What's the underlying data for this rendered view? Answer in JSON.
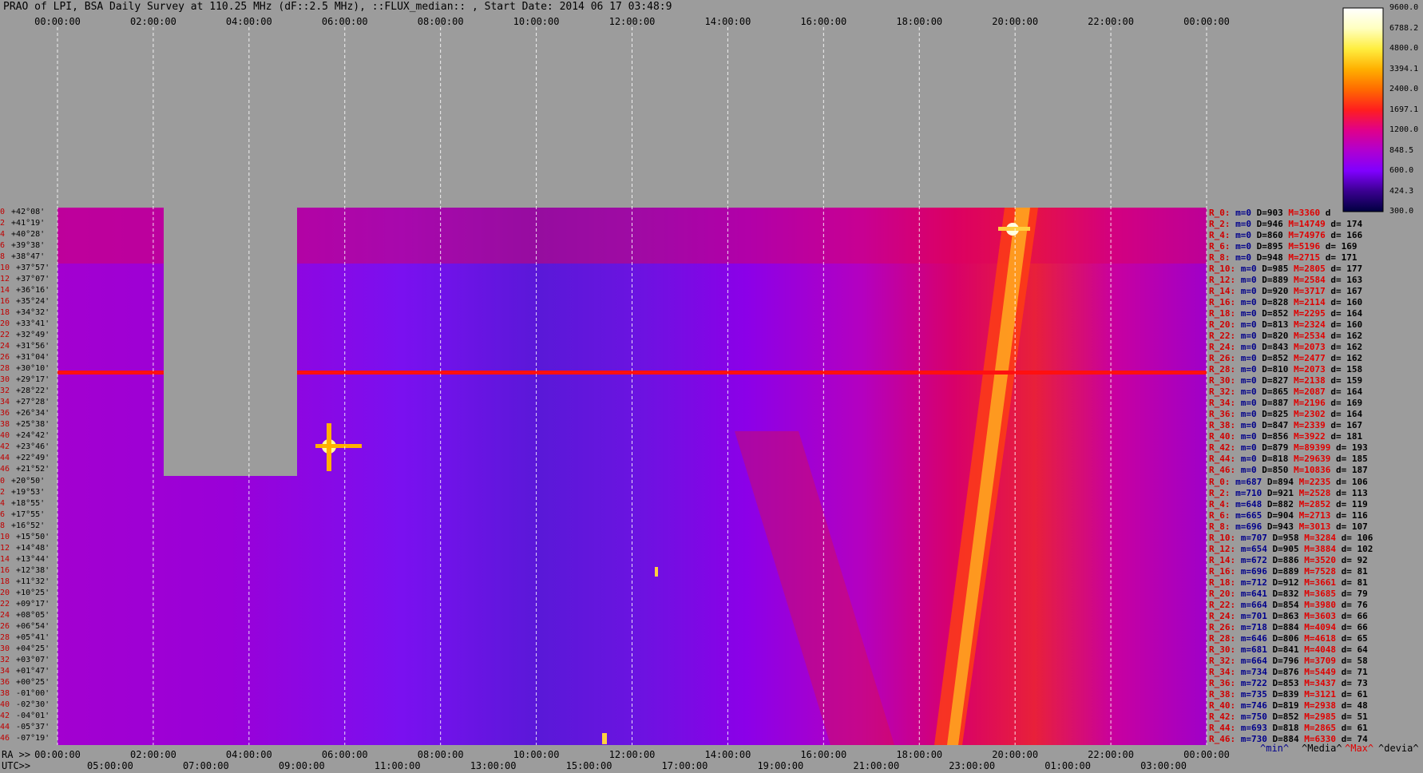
{
  "title": "PRAO of LPI, BSA Daily Survey at 110.25 MHz (dF::2.5 MHz), ::FLUX_median:: , Start Date: 2014 06 17 03:48:9",
  "chart_data": {
    "type": "heatmap",
    "title": "PRAO of LPI, BSA Daily Survey at 110.25 MHz (dF::2.5 MHz), ::FLUX_median:: , Start Date: 2014 06 17 03:48:9",
    "ra_ticks": [
      "00:00:00",
      "02:00:00",
      "04:00:00",
      "06:00:00",
      "08:00:00",
      "10:00:00",
      "12:00:00",
      "14:00:00",
      "16:00:00",
      "18:00:00",
      "20:00:00",
      "22:00:00",
      "00:00:00"
    ],
    "ra_axis_label": "RA >>",
    "utc_axis_label": "UTC>>",
    "utc_ticks": [
      "05:00:00",
      "07:00:00",
      "09:00:00",
      "11:00:00",
      "13:00:00",
      "15:00:00",
      "17:00:00",
      "19:00:00",
      "21:00:00",
      "23:00:00",
      "01:00:00",
      "03:00:00"
    ],
    "declinations": [
      "+42°08'",
      "+41°19'",
      "+40°28'",
      "+39°38'",
      "+38°47'",
      "+37°57'",
      "+37°07'",
      "+36°16'",
      "+35°24'",
      "+34°32'",
      "+33°41'",
      "+32°49'",
      "+31°56'",
      "+31°04'",
      "+30°10'",
      "+29°17'",
      "+28°22'",
      "+27°28'",
      "+26°34'",
      "+25°38'",
      "+24°42'",
      "+23°46'",
      "+22°49'",
      "+21°52'",
      "+20°50'",
      "+19°53'",
      "+18°55'",
      "+17°55'",
      "+16°52'",
      "+15°50'",
      "+14°48'",
      "+13°44'",
      "+12°38'",
      "+11°32'",
      "+10°25'",
      "+09°17'",
      "+08°05'",
      "+06°54'",
      "+05°41'",
      "+04°25'",
      "+03°07'",
      "+01°47'",
      "+00°25'",
      "-01°00'",
      "-02°30'",
      "-04°01'",
      "-05°37'",
      "-07°19'"
    ],
    "row_numbers": [
      "0",
      "2",
      "4",
      "6",
      "8",
      "10",
      "12",
      "14",
      "16",
      "18",
      "20",
      "22",
      "24",
      "26",
      "28",
      "30",
      "32",
      "34",
      "36",
      "38",
      "40",
      "42",
      "44",
      "46",
      "0",
      "2",
      "4",
      "6",
      "8",
      "10",
      "12",
      "14",
      "16",
      "18",
      "20",
      "22",
      "24",
      "26",
      "28",
      "30",
      "32",
      "34",
      "36",
      "38",
      "40",
      "42",
      "44",
      "46"
    ],
    "colorbar": {
      "ticks": [
        "9600.0",
        "6788.2",
        "4800.0",
        "3394.1",
        "2400.0",
        "1697.1",
        "1200.0",
        "848.5",
        "600.0",
        "424.3",
        "300.0"
      ],
      "colors": [
        "#000040",
        "#3a0090",
        "#8000ff",
        "#b000d0",
        "#e0008a",
        "#ff1e1e",
        "#ff6a00",
        "#ffb000",
        "#ffee40",
        "#ffffc0",
        "#ffffff"
      ]
    },
    "row_stats": [
      {
        "r": "R_0:",
        "m": "m=0",
        "D": "D=903",
        "M": "M=3360",
        "d": "d"
      },
      {
        "r": "R_2:",
        "m": "m=0",
        "D": "D=946",
        "M": "M=14749",
        "d": "d= 174"
      },
      {
        "r": "R_4:",
        "m": "m=0",
        "D": "D=860",
        "M": "M=74976",
        "d": "d= 166"
      },
      {
        "r": "R_6:",
        "m": "m=0",
        "D": "D=895",
        "M": "M=5196",
        "d": "d= 169"
      },
      {
        "r": "R_8:",
        "m": "m=0",
        "D": "D=948",
        "M": "M=2715",
        "d": "d= 171"
      },
      {
        "r": "R_10:",
        "m": "m=0",
        "D": "D=985",
        "M": "M=2805",
        "d": "d= 177"
      },
      {
        "r": "R_12:",
        "m": "m=0",
        "D": "D=889",
        "M": "M=2584",
        "d": "d= 163"
      },
      {
        "r": "R_14:",
        "m": "m=0",
        "D": "D=920",
        "M": "M=3717",
        "d": "d= 167"
      },
      {
        "r": "R_16:",
        "m": "m=0",
        "D": "D=828",
        "M": "M=2114",
        "d": "d= 160"
      },
      {
        "r": "R_18:",
        "m": "m=0",
        "D": "D=852",
        "M": "M=2295",
        "d": "d= 164"
      },
      {
        "r": "R_20:",
        "m": "m=0",
        "D": "D=813",
        "M": "M=2324",
        "d": "d= 160"
      },
      {
        "r": "R_22:",
        "m": "m=0",
        "D": "D=820",
        "M": "M=2534",
        "d": "d= 162"
      },
      {
        "r": "R_24:",
        "m": "m=0",
        "D": "D=843",
        "M": "M=2073",
        "d": "d= 162"
      },
      {
        "r": "R_26:",
        "m": "m=0",
        "D": "D=852",
        "M": "M=2477",
        "d": "d= 162"
      },
      {
        "r": "R_28:",
        "m": "m=0",
        "D": "D=810",
        "M": "M=2073",
        "d": "d= 158"
      },
      {
        "r": "R_30:",
        "m": "m=0",
        "D": "D=827",
        "M": "M=2138",
        "d": "d= 159"
      },
      {
        "r": "R_32:",
        "m": "m=0",
        "D": "D=865",
        "M": "M=2087",
        "d": "d= 164"
      },
      {
        "r": "R_34:",
        "m": "m=0",
        "D": "D=887",
        "M": "M=2196",
        "d": "d= 169"
      },
      {
        "r": "R_36:",
        "m": "m=0",
        "D": "D=825",
        "M": "M=2302",
        "d": "d= 164"
      },
      {
        "r": "R_38:",
        "m": "m=0",
        "D": "D=847",
        "M": "M=2339",
        "d": "d= 167"
      },
      {
        "r": "R_40:",
        "m": "m=0",
        "D": "D=856",
        "M": "M=3922",
        "d": "d= 181"
      },
      {
        "r": "R_42:",
        "m": "m=0",
        "D": "D=879",
        "M": "M=89399",
        "d": "d= 193"
      },
      {
        "r": "R_44:",
        "m": "m=0",
        "D": "D=818",
        "M": "M=29639",
        "d": "d= 185"
      },
      {
        "r": "R_46:",
        "m": "m=0",
        "D": "D=850",
        "M": "M=10836",
        "d": "d= 187"
      },
      {
        "r": "R_0:",
        "m": "m=687",
        "D": "D=894",
        "M": "M=2235",
        "d": "d= 106"
      },
      {
        "r": "R_2:",
        "m": "m=710",
        "D": "D=921",
        "M": "M=2528",
        "d": "d= 113"
      },
      {
        "r": "R_4:",
        "m": "m=648",
        "D": "D=882",
        "M": "M=2852",
        "d": "d= 119"
      },
      {
        "r": "R_6:",
        "m": "m=665",
        "D": "D=904",
        "M": "M=2713",
        "d": "d= 116"
      },
      {
        "r": "R_8:",
        "m": "m=696",
        "D": "D=943",
        "M": "M=3013",
        "d": "d= 107"
      },
      {
        "r": "R_10:",
        "m": "m=707",
        "D": "D=958",
        "M": "M=3284",
        "d": "d= 106"
      },
      {
        "r": "R_12:",
        "m": "m=654",
        "D": "D=905",
        "M": "M=3884",
        "d": "d= 102"
      },
      {
        "r": "R_14:",
        "m": "m=672",
        "D": "D=886",
        "M": "M=3520",
        "d": "d= 92"
      },
      {
        "r": "R_16:",
        "m": "m=696",
        "D": "D=889",
        "M": "M=7528",
        "d": "d= 81"
      },
      {
        "r": "R_18:",
        "m": "m=712",
        "D": "D=912",
        "M": "M=3661",
        "d": "d= 81"
      },
      {
        "r": "R_20:",
        "m": "m=641",
        "D": "D=832",
        "M": "M=3685",
        "d": "d= 79"
      },
      {
        "r": "R_22:",
        "m": "m=664",
        "D": "D=854",
        "M": "M=3980",
        "d": "d= 76"
      },
      {
        "r": "R_24:",
        "m": "m=701",
        "D": "D=863",
        "M": "M=3603",
        "d": "d= 66"
      },
      {
        "r": "R_26:",
        "m": "m=718",
        "D": "D=884",
        "M": "M=4094",
        "d": "d= 66"
      },
      {
        "r": "R_28:",
        "m": "m=646",
        "D": "D=806",
        "M": "M=4618",
        "d": "d= 65"
      },
      {
        "r": "R_30:",
        "m": "m=681",
        "D": "D=841",
        "M": "M=4048",
        "d": "d= 64"
      },
      {
        "r": "R_32:",
        "m": "m=664",
        "D": "D=796",
        "M": "M=3709",
        "d": "d= 58"
      },
      {
        "r": "R_34:",
        "m": "m=734",
        "D": "D=876",
        "M": "M=5449",
        "d": "d= 71"
      },
      {
        "r": "R_36:",
        "m": "m=722",
        "D": "D=853",
        "M": "M=3437",
        "d": "d= 73"
      },
      {
        "r": "R_38:",
        "m": "m=735",
        "D": "D=839",
        "M": "M=3121",
        "d": "d= 61"
      },
      {
        "r": "R_40:",
        "m": "m=746",
        "D": "D=819",
        "M": "M=2938",
        "d": "d= 48"
      },
      {
        "r": "R_42:",
        "m": "m=750",
        "D": "D=852",
        "M": "M=2985",
        "d": "d= 51"
      },
      {
        "r": "R_44:",
        "m": "m=693",
        "D": "D=818",
        "M": "M=2865",
        "d": "d= 61"
      },
      {
        "r": "R_46:",
        "m": "m=730",
        "D": "D=884",
        "M": "M=6330",
        "d": "d= 74"
      }
    ],
    "legend_keys": [
      {
        "text": "^min^",
        "color": "#00008b"
      },
      {
        "text": "^Media^",
        "color": "#000000"
      },
      {
        "text": "^Max^",
        "color": "#e00000"
      },
      {
        "text": "^devia^",
        "color": "#000000"
      }
    ]
  }
}
